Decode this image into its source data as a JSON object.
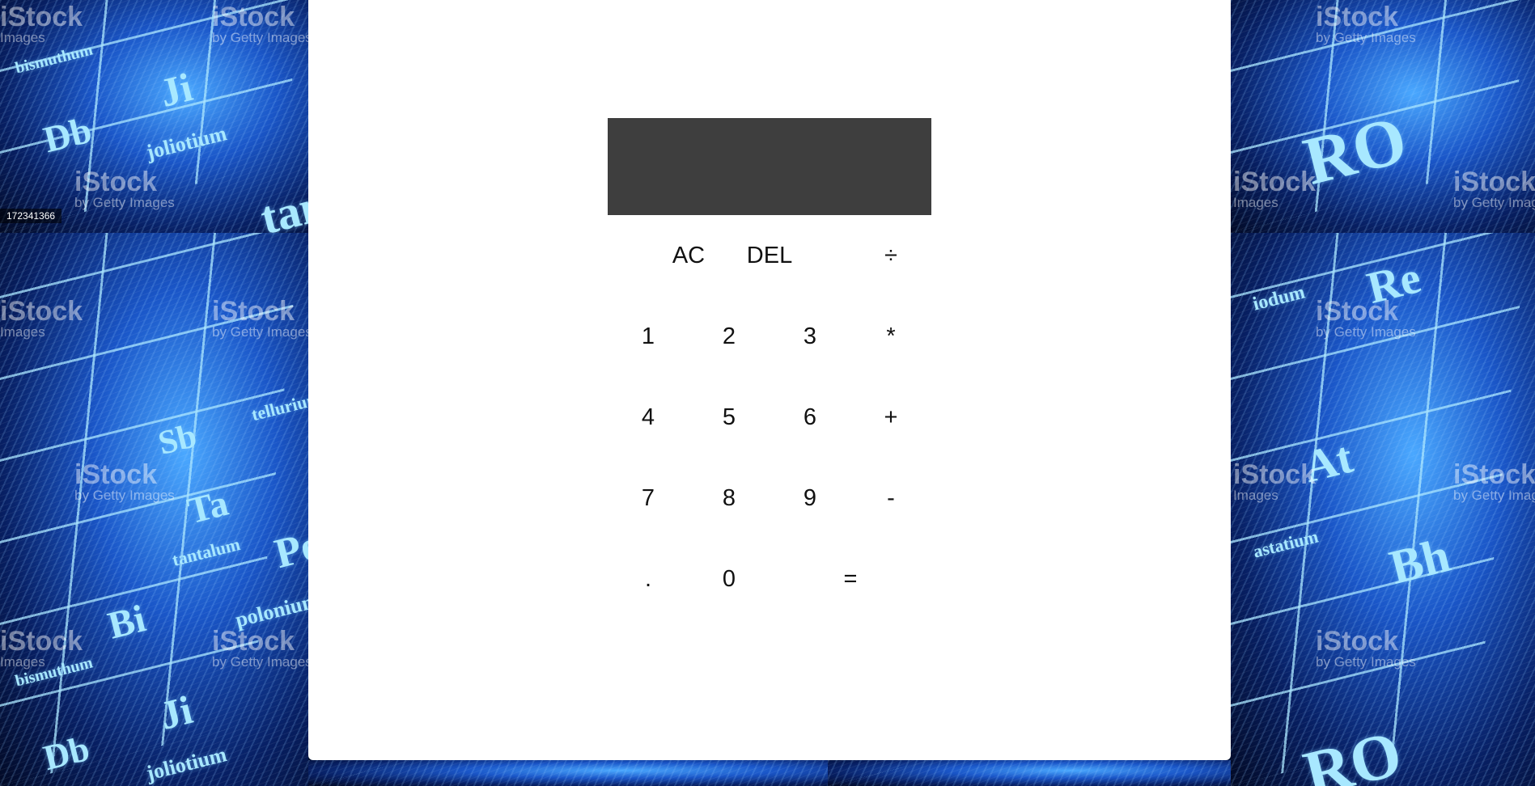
{
  "background": {
    "watermark_brand": "iStock",
    "watermark_sub": "Images",
    "watermark_sub_getty": "by Getty Images",
    "stock_id": "172341366",
    "elements": [
      "Db",
      "Ji",
      "joliotium",
      "bismuthum",
      "Bi",
      "Ta",
      "tantalum",
      "Sb",
      "Po",
      "polonium",
      "RO",
      "Re",
      "At",
      "Bh",
      "iodum",
      "astatium",
      "tellurium"
    ],
    "colors": {
      "accent": "#1a56c8",
      "line": "#a8e8ff",
      "dark": "#03102e"
    }
  },
  "calculator": {
    "display": {
      "value": "",
      "color": "#3e3e3e"
    },
    "keys": {
      "ac": "AC",
      "del": "DEL",
      "divide": "÷",
      "one": "1",
      "two": "2",
      "three": "3",
      "multiply": "*",
      "four": "4",
      "five": "5",
      "six": "6",
      "plus": "+",
      "seven": "7",
      "eight": "8",
      "nine": "9",
      "minus": "-",
      "decimal": ".",
      "zero": "0",
      "equals": "="
    }
  }
}
